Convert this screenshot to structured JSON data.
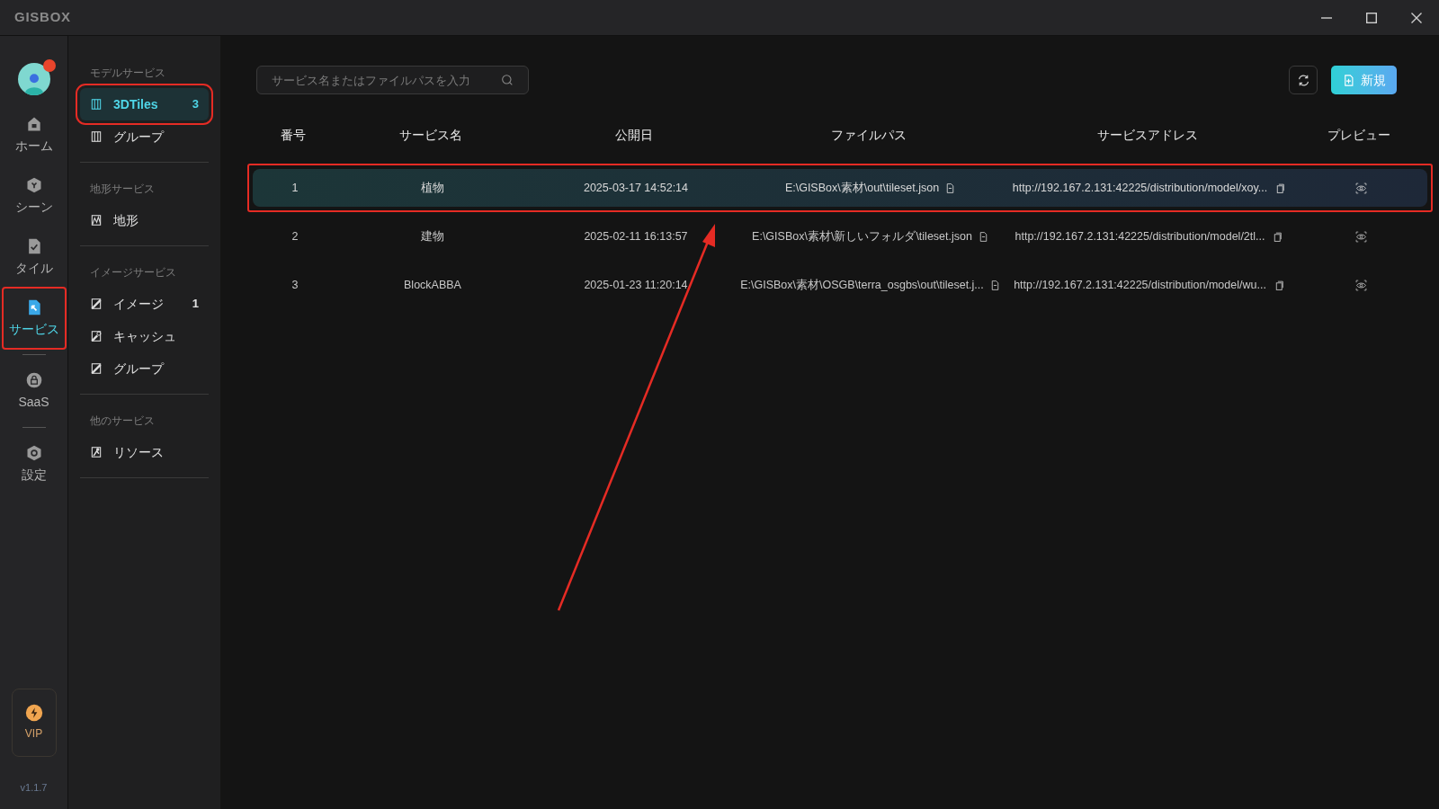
{
  "window": {
    "title": "GISBOX"
  },
  "rail": {
    "items": [
      {
        "label": "ホーム",
        "kind": "home",
        "selected": false,
        "annotated": false
      },
      {
        "label": "シーン",
        "kind": "cube",
        "selected": false,
        "annotated": false
      },
      {
        "label": "タイル",
        "kind": "file",
        "selected": false,
        "annotated": false
      },
      {
        "label": "サービス",
        "kind": "service",
        "selected": true,
        "annotated": true
      },
      {
        "label": "SaaS",
        "kind": "lock",
        "selected": false,
        "annotated": false
      },
      {
        "label": "設定",
        "kind": "gear",
        "selected": false,
        "annotated": false
      }
    ],
    "vip": "VIP",
    "version": "v1.1.7"
  },
  "nav": {
    "sections": [
      {
        "title": "モデルサービス",
        "items": [
          {
            "label": "3DTiles",
            "count": "3",
            "kind": "tiles",
            "selected": true,
            "annotated": true
          },
          {
            "label": "グループ",
            "kind": "tiles",
            "selected": false,
            "annotated": false
          }
        ]
      },
      {
        "title": "地形サービス",
        "items": [
          {
            "label": "地形",
            "kind": "terrain",
            "selected": false,
            "annotated": false
          }
        ]
      },
      {
        "title": "イメージサービス",
        "items": [
          {
            "label": "イメージ",
            "count": "1",
            "kind": "image",
            "selected": false,
            "annotated": false
          },
          {
            "label": "キャッシュ",
            "kind": "cache",
            "selected": false,
            "annotated": false
          },
          {
            "label": "グループ",
            "kind": "image",
            "selected": false,
            "annotated": false
          }
        ]
      },
      {
        "title": "他のサービス",
        "items": [
          {
            "label": "リソース",
            "kind": "resource",
            "selected": false,
            "annotated": false
          }
        ]
      }
    ]
  },
  "search": {
    "placeholder": "サービス名またはファイルパスを入力"
  },
  "new_button": "新規",
  "table": {
    "columns": [
      "番号",
      "サービス名",
      "公開日",
      "ファイルパス",
      "サービスアドレス",
      "プレビュー"
    ],
    "rows": [
      {
        "number": "1",
        "name": "植物",
        "date": "2025-03-17 14:52:14",
        "path": "E:\\GISBox\\素材\\out\\tileset.json",
        "address": "http://192.167.2.131:42225/distribution/model/xoy...",
        "selected": true,
        "annotated": true
      },
      {
        "number": "2",
        "name": "建物",
        "date": "2025-02-11 16:13:57",
        "path": "E:\\GISBox\\素材\\新しいフォルダ\\tileset.json",
        "address": "http://192.167.2.131:42225/distribution/model/2tl...",
        "selected": false,
        "annotated": false
      },
      {
        "number": "3",
        "name": "BlockABBA",
        "date": "2025-01-23 11:20:14",
        "path": "E:\\GISBox\\素材\\OSGB\\terra_osgbs\\out\\tileset.j...",
        "address": "http://192.167.2.131:42225/distribution/model/wu...",
        "selected": false,
        "annotated": false
      }
    ]
  }
}
